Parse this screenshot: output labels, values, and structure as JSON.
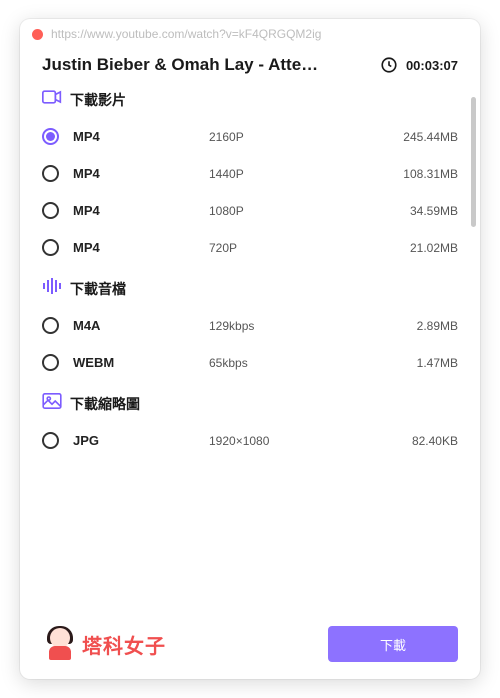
{
  "titlebar": {
    "url": "https://www.youtube.com/watch?v=kF4QRGQM2ig"
  },
  "header": {
    "title": "Justin Bieber & Omah Lay - Atte…",
    "duration": "00:03:07"
  },
  "sections": {
    "video": {
      "label": "下載影片",
      "options": [
        {
          "format": "MP4",
          "quality": "2160P",
          "size": "245.44MB",
          "selected": true
        },
        {
          "format": "MP4",
          "quality": "1440P",
          "size": "108.31MB",
          "selected": false
        },
        {
          "format": "MP4",
          "quality": "1080P",
          "size": "34.59MB",
          "selected": false
        },
        {
          "format": "MP4",
          "quality": "720P",
          "size": "21.02MB",
          "selected": false
        }
      ]
    },
    "audio": {
      "label": "下載音檔",
      "options": [
        {
          "format": "M4A",
          "quality": "129kbps",
          "size": "2.89MB",
          "selected": false
        },
        {
          "format": "WEBM",
          "quality": "65kbps",
          "size": "1.47MB",
          "selected": false
        }
      ]
    },
    "thumbnail": {
      "label": "下載縮略圖",
      "options": [
        {
          "format": "JPG",
          "quality": "1920×1080",
          "size": "82.40KB",
          "selected": false
        }
      ]
    }
  },
  "footer": {
    "brand": "塔科女子",
    "download_button": "下載"
  },
  "colors": {
    "accent": "#7c5cff",
    "brand": "#f04f4f"
  }
}
